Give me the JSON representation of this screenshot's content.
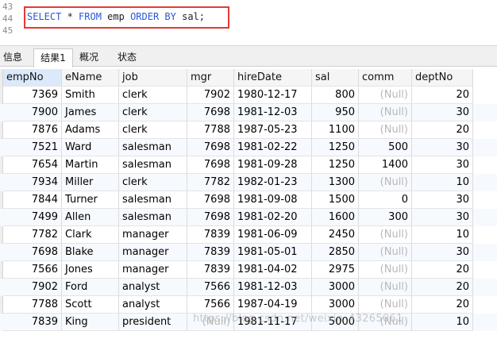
{
  "editor": {
    "line_numbers": [
      "43",
      "44",
      "45"
    ],
    "sql_tokens": [
      {
        "text": "SELECT",
        "kw": true
      },
      {
        "text": " * ",
        "kw": false
      },
      {
        "text": "FROM",
        "kw": true
      },
      {
        "text": " emp ",
        "kw": false
      },
      {
        "text": "ORDER BY",
        "kw": true
      },
      {
        "text": " sal;",
        "kw": false
      }
    ]
  },
  "tabs": [
    "信息",
    "结果1",
    "概况",
    "状态"
  ],
  "active_tab": "结果1",
  "table": {
    "columns": [
      "empNo",
      "eName",
      "job",
      "mgr",
      "hireDate",
      "sal",
      "comm",
      "deptNo"
    ],
    "selected_column": "empNo",
    "rows": [
      [
        "7369",
        "Smith",
        "clerk",
        "7902",
        "1980-12-17",
        "800",
        "(Null)",
        "20"
      ],
      [
        "7900",
        "James",
        "clerk",
        "7698",
        "1981-12-03",
        "950",
        "(Null)",
        "30"
      ],
      [
        "7876",
        "Adams",
        "clerk",
        "7788",
        "1987-05-23",
        "1100",
        "(Null)",
        "20"
      ],
      [
        "7521",
        "Ward",
        "salesman",
        "7698",
        "1981-02-22",
        "1250",
        "500",
        "30"
      ],
      [
        "7654",
        "Martin",
        "salesman",
        "7698",
        "1981-09-28",
        "1250",
        "1400",
        "30"
      ],
      [
        "7934",
        "Miller",
        "clerk",
        "7782",
        "1982-01-23",
        "1300",
        "(Null)",
        "10"
      ],
      [
        "7844",
        "Turner",
        "salesman",
        "7698",
        "1981-09-08",
        "1500",
        "0",
        "30"
      ],
      [
        "7499",
        "Allen",
        "salesman",
        "7698",
        "1981-02-20",
        "1600",
        "300",
        "30"
      ],
      [
        "7782",
        "Clark",
        "manager",
        "7839",
        "1981-06-09",
        "2450",
        "(Null)",
        "10"
      ],
      [
        "7698",
        "Blake",
        "manager",
        "7839",
        "1981-05-01",
        "2850",
        "(Null)",
        "30"
      ],
      [
        "7566",
        "Jones",
        "manager",
        "7839",
        "1981-04-02",
        "2975",
        "(Null)",
        "20"
      ],
      [
        "7902",
        "Ford",
        "analyst",
        "7566",
        "1981-12-03",
        "3000",
        "(Null)",
        "20"
      ],
      [
        "7788",
        "Scott",
        "analyst",
        "7566",
        "1987-04-19",
        "3000",
        "(Null)",
        "20"
      ],
      [
        "7839",
        "King",
        "president",
        "(Null)",
        "1981-11-17",
        "5000",
        "(Null)",
        "10"
      ]
    ]
  },
  "watermark": "https://blog.csdn.net/weixin_43265061"
}
